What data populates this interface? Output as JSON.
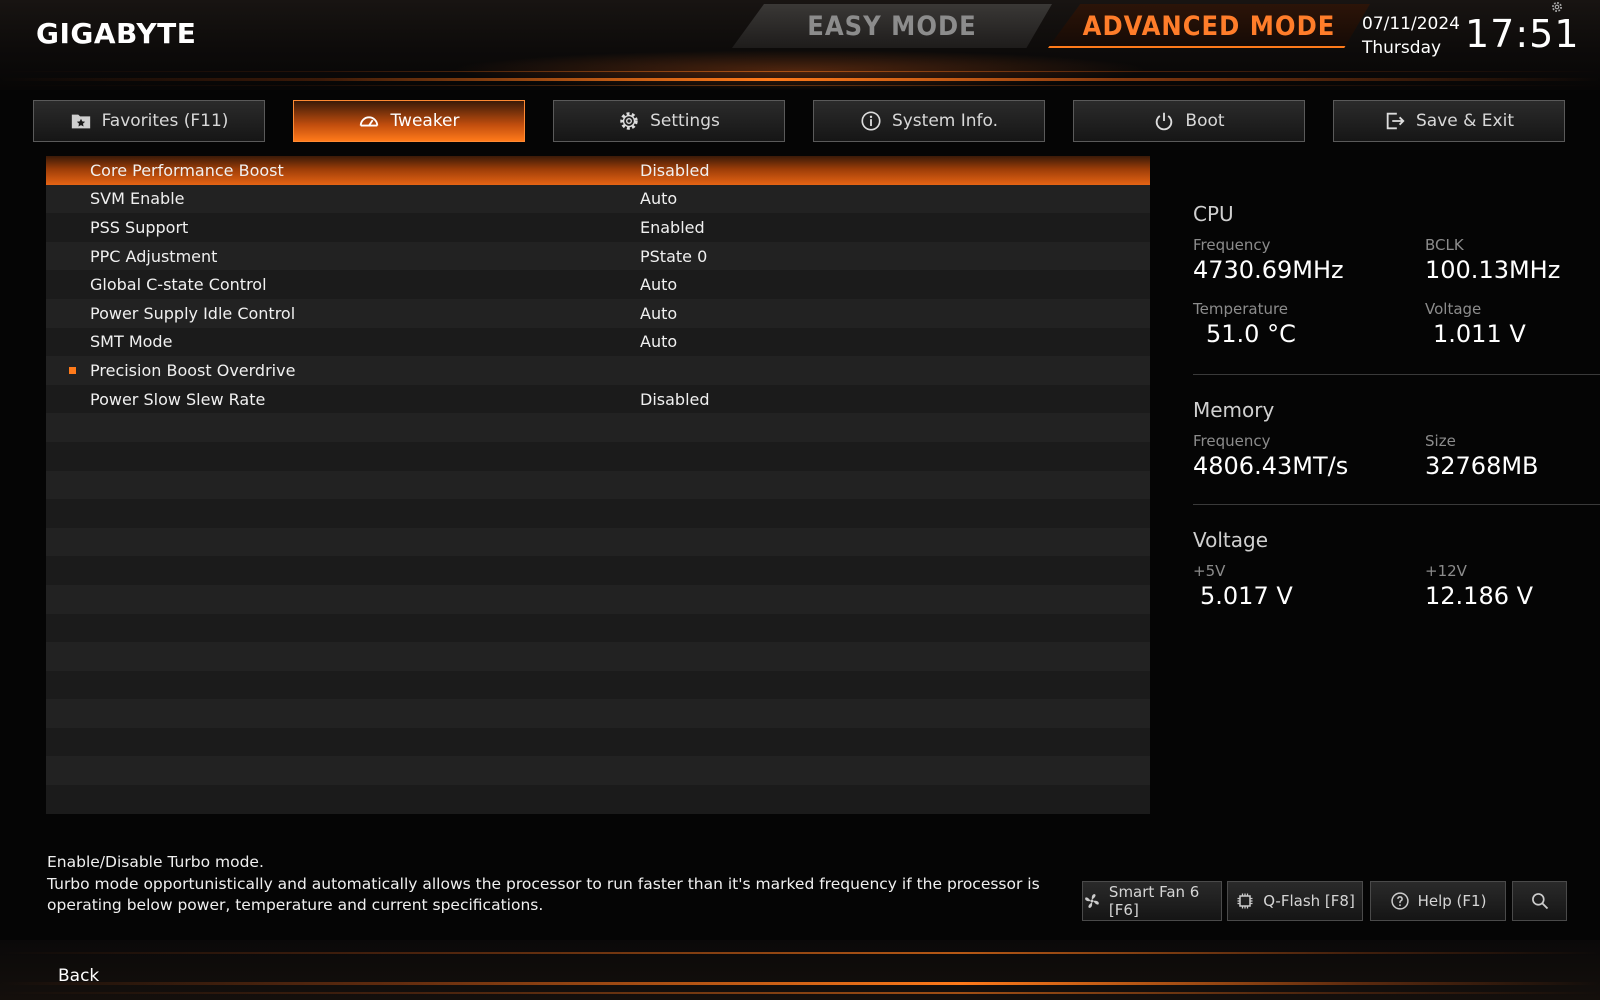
{
  "header": {
    "logo": "GIGABYTE",
    "easy_mode": "EASY MODE",
    "advanced_mode": "ADVANCED MODE",
    "date": "07/11/2024",
    "day": "Thursday",
    "time": "17:51"
  },
  "tabs": [
    {
      "label": "Favorites (F11)",
      "icon": "star-folder-icon"
    },
    {
      "label": "Tweaker",
      "icon": "speedometer-icon",
      "active": true
    },
    {
      "label": "Settings",
      "icon": "gear-icon"
    },
    {
      "label": "System Info.",
      "icon": "info-icon"
    },
    {
      "label": "Boot",
      "icon": "power-icon"
    },
    {
      "label": "Save & Exit",
      "icon": "exit-icon"
    }
  ],
  "settings": [
    {
      "label": "Core Performance Boost",
      "value": "Disabled"
    },
    {
      "label": "SVM Enable",
      "value": "Auto"
    },
    {
      "label": "PSS Support",
      "value": "Enabled"
    },
    {
      "label": "PPC Adjustment",
      "value": "PState 0"
    },
    {
      "label": "Global C-state Control",
      "value": "Auto"
    },
    {
      "label": "Power Supply Idle Control",
      "value": "Auto"
    },
    {
      "label": "SMT Mode",
      "value": "Auto"
    },
    {
      "label": "Precision Boost Overdrive",
      "value": ""
    },
    {
      "label": "Power Slow Slew Rate",
      "value": "Disabled"
    }
  ],
  "info": {
    "cpu": {
      "title": "CPU",
      "frequency_label": "Frequency",
      "frequency": "4730.69MHz",
      "bclk_label": "BCLK",
      "bclk": "100.13MHz",
      "temperature_label": "Temperature",
      "temperature": "51.0 °C",
      "voltage_label": "Voltage",
      "voltage": "1.011 V"
    },
    "memory": {
      "title": "Memory",
      "frequency_label": "Frequency",
      "frequency": "4806.43MT/s",
      "size_label": "Size",
      "size": "32768MB"
    },
    "voltage": {
      "title": "Voltage",
      "v5_label": "+5V",
      "v5": "5.017 V",
      "v12_label": "+12V",
      "v12": "12.186 V"
    }
  },
  "description": {
    "line1": "Enable/Disable Turbo mode.",
    "line2": "Turbo mode opportunistically and automatically allows the processor to run faster than it's marked frequency if the processor is operating below power, temperature and current specifications."
  },
  "footer": {
    "smart_fan": "Smart Fan 6 [F6]",
    "qflash": "Q-Flash [F8]",
    "help": "Help (F1)",
    "back": "Back"
  },
  "colors": {
    "accent": "#ff7a1a",
    "background": "#050505",
    "row_odd": "#1b1b1b",
    "row_even": "#222222"
  }
}
